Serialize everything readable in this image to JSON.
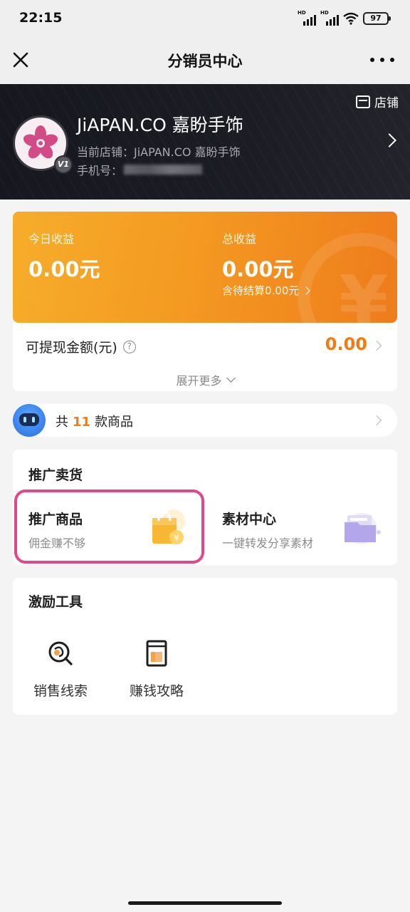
{
  "status_bar": {
    "time": "22:15",
    "battery": "97",
    "signal_label": "HD"
  },
  "title_bar": {
    "title": "分销员中心"
  },
  "header": {
    "shop_link_label": "店铺",
    "store_name": "JiAPAN.CO 嘉盼手饰",
    "current_store": "当前店铺：JiAPAN.CO 嘉盼手饰",
    "phone_label": "手机号：",
    "level_badge": "V1"
  },
  "earnings": {
    "today_label": "今日收益",
    "today_value": "0.00元",
    "total_label": "总收益",
    "total_value": "0.00元",
    "pending": "含待结算0.00元",
    "withdraw_label": "可提现金额(元)",
    "withdraw_value": "0.00",
    "expand_more": "展开更多"
  },
  "products": {
    "prefix": "共",
    "count": "11",
    "suffix": "款商品"
  },
  "promote": {
    "section_title": "推广卖货",
    "tiles": [
      {
        "title": "推广商品",
        "subtitle": "佣金赚不够",
        "icon": "shopping-bag-icon"
      },
      {
        "title": "素材中心",
        "subtitle": "一键转发分享素材",
        "icon": "folder-icon"
      }
    ]
  },
  "tools": {
    "section_title": "激励工具",
    "items": [
      {
        "label": "销售线索",
        "icon": "sales-leads-icon"
      },
      {
        "label": "赚钱攻略",
        "icon": "guide-book-icon"
      }
    ]
  },
  "colors": {
    "accent": "#f07a16",
    "highlight": "#e0488a",
    "banner": "#1b1c24"
  }
}
